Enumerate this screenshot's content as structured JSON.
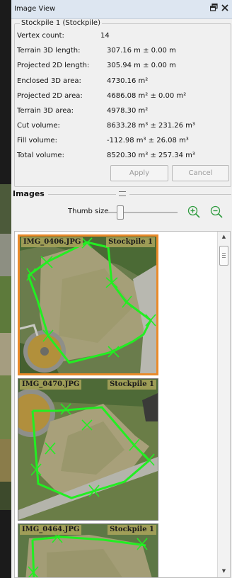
{
  "window": {
    "title": "Image View"
  },
  "details": {
    "group_title": "Stockpile 1 (Stockpile)",
    "rows": [
      {
        "label": "Vertex count:",
        "value": "14"
      },
      {
        "label": "Terrain 3D length:",
        "value": "307.16 m  ± 0.00 m"
      },
      {
        "label": "Projected 2D length:",
        "value": "305.94 m  ± 0.00 m"
      },
      {
        "label": "Enclosed 3D area:",
        "value": "4730.16 m²"
      },
      {
        "label": "Projected 2D area:",
        "value": "4686.08 m² ± 0.00 m²"
      },
      {
        "label": "Terrain 3D area:",
        "value": "4978.30 m²"
      },
      {
        "label": "Cut volume:",
        "value": "8633.28 m³ ± 231.26 m³"
      },
      {
        "label": "Fill volume:",
        "value": "-112.98 m³ ± 26.08 m³"
      },
      {
        "label": "Total volume:",
        "value": "8520.30 m³ ± 257.34 m³"
      }
    ],
    "apply_label": "Apply",
    "cancel_label": "Cancel"
  },
  "images": {
    "header": "Images",
    "thumb_size_label": "Thumb size",
    "thumb_size_level": 0.12,
    "thumbnails": [
      {
        "name": "IMG_0406.JPG",
        "object": "Stockpile 1",
        "selected": true
      },
      {
        "name": "IMG_0470.JPG",
        "object": "Stockpile 1",
        "selected": false
      },
      {
        "name": "IMG_0464.JPG",
        "object": "Stockpile 1",
        "selected": false
      }
    ]
  },
  "icons": {
    "dock": "restore-icon",
    "close": "close-icon",
    "zoom_in": "zoom-in-icon",
    "zoom_out": "zoom-out-icon"
  },
  "colors": {
    "titlebar": "#dde6f1",
    "selection": "#e98a2a",
    "outline": "#22ee22",
    "zoom_icon": "#2f9c3f"
  }
}
